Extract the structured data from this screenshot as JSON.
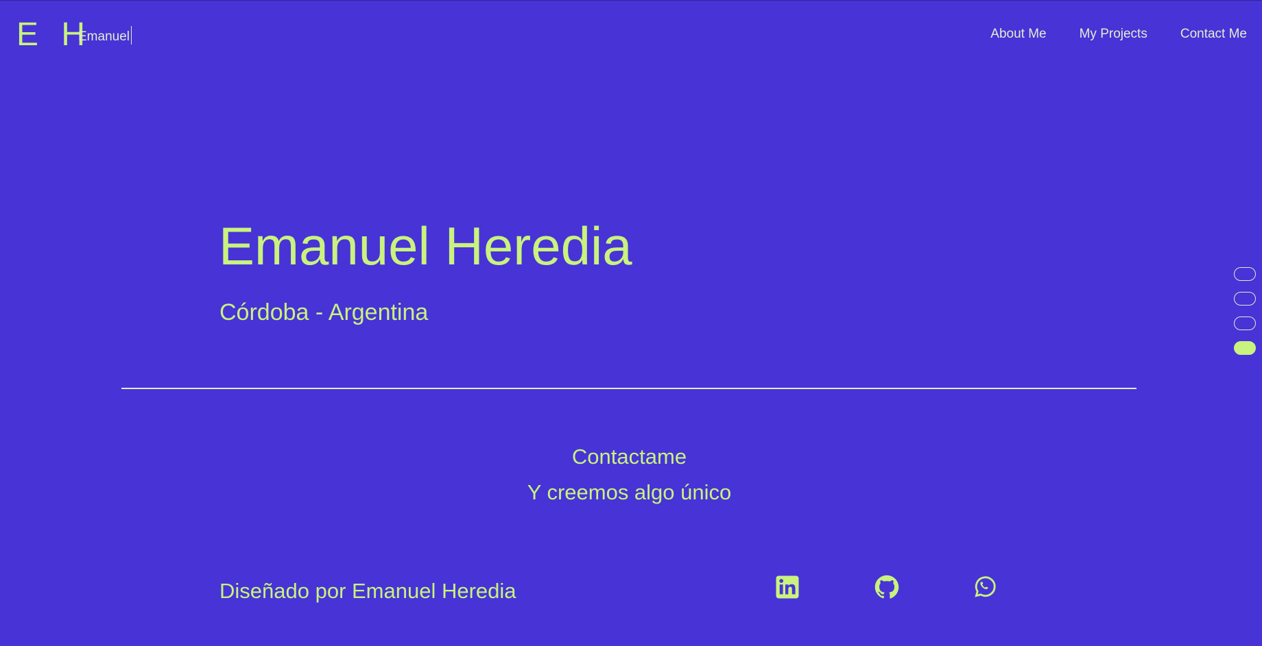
{
  "header": {
    "logo": "E H",
    "typed_text": "Emanuel",
    "nav": [
      {
        "label": "About Me"
      },
      {
        "label": "My Projects"
      },
      {
        "label": "Contact Me"
      }
    ]
  },
  "hero": {
    "name": "Emanuel Heredia",
    "location": "Córdoba - Argentina"
  },
  "contact": {
    "line1": "Contactame",
    "line2": "Y creemos algo único"
  },
  "footer": {
    "credits": "Diseñado por Emanuel Heredia",
    "social_icons": [
      "linkedin-icon",
      "github-icon",
      "whatsapp-icon"
    ]
  },
  "section_indicator": {
    "count": 4,
    "active_index": 3
  },
  "colors": {
    "background": "#4733d6",
    "accent": "#c9f27e",
    "text_light": "#e4ecd0"
  }
}
